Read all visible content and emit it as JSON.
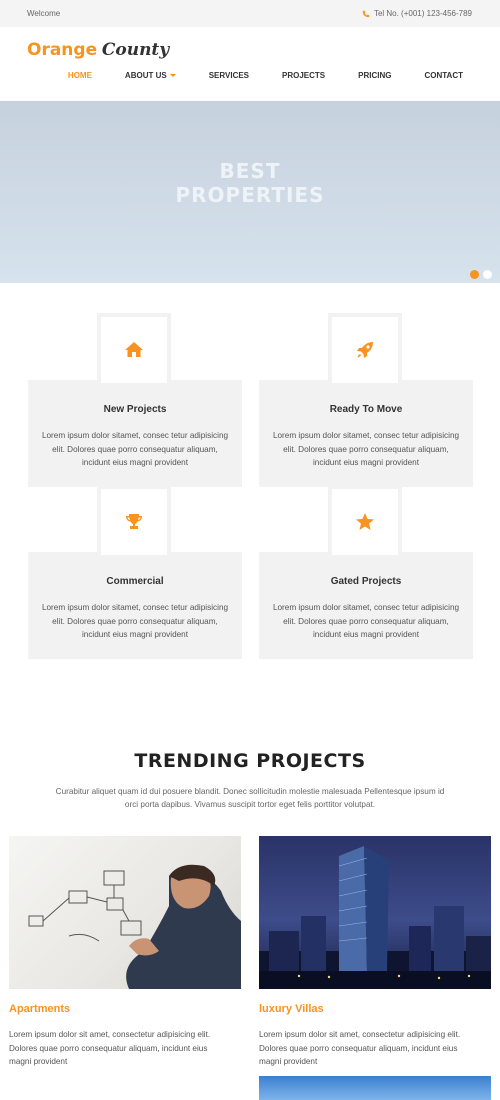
{
  "topbar": {
    "welcome": "Welcome",
    "phone": "Tel No. (+001) 123-456-789"
  },
  "header": {
    "logo_part1": "Orange",
    "logo_part2": "County",
    "nav": [
      {
        "label": "HOME",
        "active": true
      },
      {
        "label": "ABOUT US",
        "dropdown": true
      },
      {
        "label": "SERVICES"
      },
      {
        "label": "PROJECTS"
      },
      {
        "label": "PRICING"
      },
      {
        "label": "CONTACT"
      }
    ]
  },
  "hero": {
    "title_line1": "BEST",
    "title_line2": "PROPERTIES",
    "slides": 2,
    "active_slide": 1
  },
  "features": [
    {
      "icon": "home-icon",
      "title": "New Projects",
      "text": "Lorem ipsum dolor sitamet, consec tetur adipisicing elit. Dolores quae porro consequatur aliquam, incidunt eius magni provident"
    },
    {
      "icon": "rocket-icon",
      "title": "Ready To Move",
      "text": "Lorem ipsum dolor sitamet, consec tetur adipisicing elit. Dolores quae porro consequatur aliquam, incidunt eius magni provident"
    },
    {
      "icon": "trophy-icon",
      "title": "Commercial",
      "text": "Lorem ipsum dolor sitamet, consec tetur adipisicing elit. Dolores quae porro consequatur aliquam, incidunt eius magni provident"
    },
    {
      "icon": "star-icon",
      "title": "Gated Projects",
      "text": "Lorem ipsum dolor sitamet, consec tetur adipisicing elit. Dolores quae porro consequatur aliquam, incidunt eius magni provident"
    }
  ],
  "trending": {
    "title": "TRENDING PROJECTS",
    "subtitle": "Curabitur aliquet quam id dui posuere blandit. Donec sollicitudin molestie malesuada Pellentesque ipsum id orci porta dapibus. Vivamus suscipit tortor eget felis porttitor volutpat.",
    "projects": [
      {
        "title": "Apartments",
        "text": "Lorem ipsum dolor sit amet, consectetur adipisicing elit. Dolores quae porro consequatur aliquam, incidunt eius magni provident"
      },
      {
        "title": "luxury Villas",
        "text": "Lorem ipsum dolor sit amet, consectetur adipisicing elit. Dolores quae porro consequatur aliquam, incidunt eius magni provident"
      }
    ]
  },
  "colors": {
    "accent": "#f7931e",
    "card_bg": "#f2f2f2",
    "hero_bg": "#d0dce8"
  }
}
